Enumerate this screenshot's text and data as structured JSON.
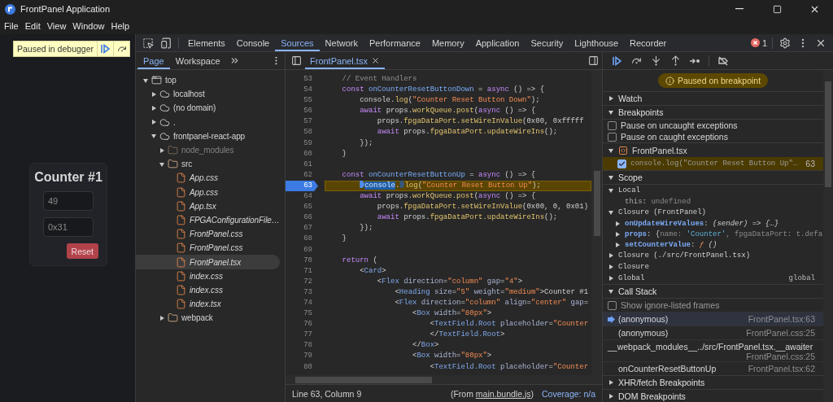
{
  "window": {
    "title": "FrontPanel Application"
  },
  "menu": [
    "File",
    "Edit",
    "View",
    "Window",
    "Help"
  ],
  "app": {
    "banner": "Paused in debugger",
    "card": {
      "title": "Counter #1",
      "fields": [
        {
          "value": "49"
        },
        {
          "value": "0x31"
        }
      ],
      "button": "Reset"
    }
  },
  "devtools_tabs": [
    {
      "label": "Elements",
      "selected": false
    },
    {
      "label": "Console",
      "selected": false
    },
    {
      "label": "Sources",
      "selected": true
    },
    {
      "label": "Network",
      "selected": false
    },
    {
      "label": "Performance",
      "selected": false
    },
    {
      "label": "Memory",
      "selected": false
    },
    {
      "label": "Application",
      "selected": false
    },
    {
      "label": "Security",
      "selected": false
    },
    {
      "label": "Lighthouse",
      "selected": false
    },
    {
      "label": "Recorder",
      "selected": false
    }
  ],
  "error_count": "1",
  "navigator": {
    "tabs": [
      {
        "label": "Page",
        "selected": true
      },
      {
        "label": "Workspace",
        "selected": false
      }
    ],
    "tree": [
      {
        "kind": "frame",
        "label": "top",
        "expanded": true,
        "selected": false,
        "children": [
          {
            "kind": "domain",
            "label": "localhost",
            "expanded": false,
            "selected": false
          },
          {
            "kind": "domain",
            "label": "(no domain)",
            "expanded": false,
            "selected": false
          },
          {
            "kind": "domain",
            "label": ".",
            "expanded": false,
            "selected": false
          },
          {
            "kind": "domain",
            "label": "frontpanel-react-app",
            "expanded": true,
            "selected": false,
            "children": [
              {
                "kind": "folder",
                "label": "node_modules",
                "expanded": false,
                "ignored": true,
                "selected": false
              },
              {
                "kind": "folder",
                "label": "src",
                "expanded": true,
                "ignored": false,
                "selected": false,
                "children": [
                  {
                    "kind": "file",
                    "label": "App.css",
                    "selected": false
                  },
                  {
                    "kind": "file",
                    "label": "App.css",
                    "selected": false
                  },
                  {
                    "kind": "file",
                    "label": "App.tsx",
                    "selected": false
                  },
                  {
                    "kind": "file",
                    "label": "FPGAConfigurationFile…",
                    "selected": false
                  },
                  {
                    "kind": "file",
                    "label": "FrontPanel.css",
                    "selected": false
                  },
                  {
                    "kind": "file",
                    "label": "FrontPanel.css",
                    "selected": false
                  },
                  {
                    "kind": "file",
                    "label": "FrontPanel.tsx",
                    "selected": true
                  },
                  {
                    "kind": "file",
                    "label": "index.css",
                    "selected": false
                  },
                  {
                    "kind": "file",
                    "label": "index.css",
                    "selected": false
                  },
                  {
                    "kind": "file",
                    "label": "index.tsx",
                    "selected": false
                  }
                ]
              },
              {
                "kind": "folder",
                "label": "webpack",
                "expanded": false,
                "ignored": false,
                "selected": false
              }
            ]
          }
        ]
      }
    ]
  },
  "editor": {
    "tabs": [
      {
        "label": "FrontPanel.tsx",
        "selected": true
      }
    ],
    "lines": [
      {
        "number": "53",
        "breakpoint": false,
        "paused": false,
        "segments": [
          {
            "kind": "comment",
            "text": "    // Event Handlers"
          }
        ]
      },
      {
        "number": "54",
        "breakpoint": false,
        "paused": false,
        "segments": [
          {
            "kind": "keyword",
            "text": "    const "
          },
          {
            "kind": "definition",
            "text": "onCounterResetButtonDown"
          },
          {
            "kind": "plain",
            "text": " = "
          },
          {
            "kind": "keyword",
            "text": "async"
          },
          {
            "kind": "plain",
            "text": " () => {"
          }
        ]
      },
      {
        "number": "55",
        "breakpoint": false,
        "paused": false,
        "segments": [
          {
            "kind": "plain",
            "text": "        console."
          },
          {
            "kind": "member",
            "text": "log"
          },
          {
            "kind": "plain",
            "text": "("
          },
          {
            "kind": "string",
            "text": "\"Counter Reset Button Down\""
          },
          {
            "kind": "plain",
            "text": ");"
          }
        ]
      },
      {
        "number": "56",
        "breakpoint": false,
        "paused": false,
        "segments": [
          {
            "kind": "keyword",
            "text": "        await "
          },
          {
            "kind": "plain",
            "text": "props."
          },
          {
            "kind": "member",
            "text": "workQueue.post"
          },
          {
            "kind": "plain",
            "text": "("
          },
          {
            "kind": "keyword",
            "text": "async"
          },
          {
            "kind": "plain",
            "text": " () => {"
          }
        ]
      },
      {
        "number": "57",
        "breakpoint": false,
        "paused": false,
        "segments": [
          {
            "kind": "plain",
            "text": "            props."
          },
          {
            "kind": "member",
            "text": "fpgaDataPort.setWireInValue"
          },
          {
            "kind": "plain",
            "text": "(0x00, 0xfffff"
          }
        ]
      },
      {
        "number": "58",
        "breakpoint": false,
        "paused": false,
        "segments": [
          {
            "kind": "keyword",
            "text": "            await "
          },
          {
            "kind": "plain",
            "text": "props."
          },
          {
            "kind": "member",
            "text": "fpgaDataPort.updateWireIns"
          },
          {
            "kind": "plain",
            "text": "();"
          }
        ]
      },
      {
        "number": "59",
        "breakpoint": false,
        "paused": false,
        "segments": [
          {
            "kind": "plain",
            "text": "        });"
          }
        ]
      },
      {
        "number": "60",
        "breakpoint": false,
        "paused": false,
        "segments": [
          {
            "kind": "plain",
            "text": "    }"
          }
        ]
      },
      {
        "number": "61",
        "breakpoint": false,
        "paused": false
      },
      {
        "number": "62",
        "breakpoint": false,
        "paused": false,
        "segments": [
          {
            "kind": "keyword",
            "text": "    const "
          },
          {
            "kind": "definition",
            "text": "onCounterResetButtonUp"
          },
          {
            "kind": "plain",
            "text": " = "
          },
          {
            "kind": "keyword",
            "text": "async"
          },
          {
            "kind": "plain",
            "text": " () => {"
          }
        ]
      },
      {
        "number": "63",
        "breakpoint": true,
        "paused": true,
        "segments": [
          {
            "kind": "paused-selection",
            "text": "        console"
          },
          {
            "kind": "plain",
            "text": "."
          },
          {
            "kind": "member-breakpoint",
            "text": "log"
          },
          {
            "kind": "plain",
            "text": "("
          },
          {
            "kind": "string",
            "text": "\"Counter Reset Button Up\""
          },
          {
            "kind": "plain",
            "text": ");"
          }
        ]
      },
      {
        "number": "64",
        "breakpoint": false,
        "paused": false,
        "segments": [
          {
            "kind": "keyword",
            "text": "        await "
          },
          {
            "kind": "plain",
            "text": "props."
          },
          {
            "kind": "member",
            "text": "workQueue.post"
          },
          {
            "kind": "plain",
            "text": "("
          },
          {
            "kind": "keyword",
            "text": "async"
          },
          {
            "kind": "plain",
            "text": " () => {"
          }
        ]
      },
      {
        "number": "65",
        "breakpoint": false,
        "paused": false,
        "segments": [
          {
            "kind": "plain",
            "text": "            props."
          },
          {
            "kind": "member",
            "text": "fpgaDataPort.setWireInValue"
          },
          {
            "kind": "plain",
            "text": "(0x00, 0, 0x01)"
          }
        ]
      },
      {
        "number": "66",
        "breakpoint": false,
        "paused": false,
        "segments": [
          {
            "kind": "keyword",
            "text": "            await "
          },
          {
            "kind": "plain",
            "text": "props."
          },
          {
            "kind": "member",
            "text": "fpgaDataPort.updateWireIns"
          },
          {
            "kind": "plain",
            "text": "();"
          }
        ]
      },
      {
        "number": "67",
        "breakpoint": false,
        "paused": false,
        "segments": [
          {
            "kind": "plain",
            "text": "        });"
          }
        ]
      },
      {
        "number": "68",
        "breakpoint": false,
        "paused": false,
        "segments": [
          {
            "kind": "plain",
            "text": "    }"
          }
        ]
      },
      {
        "number": "69",
        "breakpoint": false,
        "paused": false
      },
      {
        "number": "70",
        "breakpoint": false,
        "paused": false,
        "segments": [
          {
            "kind": "keyword",
            "text": "    return"
          },
          {
            "kind": "plain",
            "text": " ("
          }
        ]
      },
      {
        "number": "71",
        "breakpoint": false,
        "paused": false,
        "segments": [
          {
            "kind": "plain",
            "text": "        <"
          },
          {
            "kind": "tag",
            "text": "Card"
          },
          {
            "kind": "plain",
            "text": ">"
          }
        ]
      },
      {
        "number": "72",
        "breakpoint": false,
        "paused": false,
        "segments": [
          {
            "kind": "plain",
            "text": "            <"
          },
          {
            "kind": "tag",
            "text": "Flex"
          },
          {
            "kind": "attribute",
            "text": " direction"
          },
          {
            "kind": "plain",
            "text": "="
          },
          {
            "kind": "string",
            "text": "\"column\""
          },
          {
            "kind": "attribute",
            "text": " gap"
          },
          {
            "kind": "plain",
            "text": "="
          },
          {
            "kind": "string",
            "text": "\"4\""
          },
          {
            "kind": "plain",
            "text": ">"
          }
        ]
      },
      {
        "number": "73",
        "breakpoint": false,
        "paused": false,
        "segments": [
          {
            "kind": "plain",
            "text": "                <"
          },
          {
            "kind": "tag",
            "text": "Heading"
          },
          {
            "kind": "attribute",
            "text": " size"
          },
          {
            "kind": "plain",
            "text": "="
          },
          {
            "kind": "string",
            "text": "\"5\""
          },
          {
            "kind": "attribute",
            "text": " weight"
          },
          {
            "kind": "plain",
            "text": "="
          },
          {
            "kind": "string",
            "text": "\"medium\""
          },
          {
            "kind": "plain",
            "text": ">Counter #1"
          }
        ]
      },
      {
        "number": "74",
        "breakpoint": false,
        "paused": false,
        "segments": [
          {
            "kind": "plain",
            "text": "                <"
          },
          {
            "kind": "tag",
            "text": "Flex"
          },
          {
            "kind": "attribute",
            "text": " direction"
          },
          {
            "kind": "plain",
            "text": "="
          },
          {
            "kind": "string",
            "text": "\"column\""
          },
          {
            "kind": "attribute",
            "text": " align"
          },
          {
            "kind": "plain",
            "text": "="
          },
          {
            "kind": "string",
            "text": "\"center\""
          },
          {
            "kind": "attribute",
            "text": " gap"
          },
          {
            "kind": "plain",
            "text": "="
          }
        ]
      },
      {
        "number": "75",
        "breakpoint": false,
        "paused": false,
        "segments": [
          {
            "kind": "plain",
            "text": "                    <"
          },
          {
            "kind": "tag",
            "text": "Box"
          },
          {
            "kind": "attribute",
            "text": " width"
          },
          {
            "kind": "plain",
            "text": "="
          },
          {
            "kind": "string",
            "text": "\"80px\""
          },
          {
            "kind": "plain",
            "text": ">"
          }
        ]
      },
      {
        "number": "76",
        "breakpoint": false,
        "paused": false,
        "segments": [
          {
            "kind": "plain",
            "text": "                        <"
          },
          {
            "kind": "tag",
            "text": "TextField.Root"
          },
          {
            "kind": "attribute",
            "text": " placeholder"
          },
          {
            "kind": "plain",
            "text": "="
          },
          {
            "kind": "string",
            "text": "\"Counter"
          }
        ]
      },
      {
        "number": "77",
        "breakpoint": false,
        "paused": false,
        "segments": [
          {
            "kind": "plain",
            "text": "                        </"
          },
          {
            "kind": "tag",
            "text": "TextField.Root"
          },
          {
            "kind": "plain",
            "text": ">"
          }
        ]
      },
      {
        "number": "78",
        "breakpoint": false,
        "paused": false,
        "segments": [
          {
            "kind": "plain",
            "text": "                    </"
          },
          {
            "kind": "tag",
            "text": "Box"
          },
          {
            "kind": "plain",
            "text": ">"
          }
        ]
      },
      {
        "number": "79",
        "breakpoint": false,
        "paused": false,
        "segments": [
          {
            "kind": "plain",
            "text": "                    <"
          },
          {
            "kind": "tag",
            "text": "Box"
          },
          {
            "kind": "attribute",
            "text": " width"
          },
          {
            "kind": "plain",
            "text": "="
          },
          {
            "kind": "string",
            "text": "\"80px\""
          },
          {
            "kind": "plain",
            "text": ">"
          }
        ]
      },
      {
        "number": "80",
        "breakpoint": false,
        "paused": false,
        "segments": [
          {
            "kind": "plain",
            "text": "                        <"
          },
          {
            "kind": "tag",
            "text": "TextField.Root"
          },
          {
            "kind": "attribute",
            "text": " placeholder"
          },
          {
            "kind": "plain",
            "text": "="
          },
          {
            "kind": "string",
            "text": "\"Counter"
          }
        ]
      }
    ],
    "status": {
      "position": "Line 63, Column 9",
      "source_prefix": "(From",
      "source_link": "main.bundle.js",
      "source_suffix": ")",
      "coverage": "Coverage: n/a"
    }
  },
  "debugger": {
    "paused_message": "Paused on breakpoint",
    "sections": [
      {
        "kind": "plain",
        "title": "Watch",
        "expanded": false
      },
      {
        "kind": "breakpoints",
        "title": "Breakpoints",
        "expanded": true,
        "options": [
          {
            "label": "Pause on uncaught exceptions",
            "checked": false
          },
          {
            "label": "Pause on caught exceptions",
            "checked": false
          }
        ],
        "files": [
          {
            "name": "FrontPanel.tsx",
            "expanded": true,
            "items": [
              {
                "code": "console.log(\"Counter Reset Button Up\"…",
                "line": "63",
                "checked": true,
                "active": true
              }
            ]
          }
        ]
      },
      {
        "kind": "scope",
        "title": "Scope",
        "expanded": true,
        "groups": [
          {
            "label": "Local",
            "expanded": true,
            "children": [
              {
                "kind": "leaf",
                "segments": [
                  {
                    "kind": "name",
                    "text": "this"
                  },
                  {
                    "kind": "plain",
                    "text": ": "
                  },
                  {
                    "kind": "dim",
                    "text": "undefined"
                  }
                ]
              }
            ]
          },
          {
            "label": "Closure (FrontPanel)",
            "expanded": true,
            "children": [
              {
                "kind": "node",
                "expanded": false,
                "segments": [
                  {
                    "kind": "property",
                    "text": "onUpdateWireValues"
                  },
                  {
                    "kind": "plain",
                    "text": ": "
                  },
                  {
                    "kind": "function",
                    "text": "(sender) => {…}"
                  }
                ]
              },
              {
                "kind": "node",
                "expanded": false,
                "segments": [
                  {
                    "kind": "property",
                    "text": "props"
                  },
                  {
                    "kind": "plain",
                    "text": ": {"
                  },
                  {
                    "kind": "dim",
                    "text": "name: "
                  },
                  {
                    "kind": "value-string",
                    "text": "'Counter'"
                  },
                  {
                    "kind": "dim",
                    "text": ", fpgaDataPort: t.defa"
                  }
                ]
              },
              {
                "kind": "node",
                "expanded": false,
                "segments": [
                  {
                    "kind": "property",
                    "text": "setCounterValue"
                  },
                  {
                    "kind": "plain",
                    "text": ": "
                  },
                  {
                    "kind": "function-keyword",
                    "text": "ƒ"
                  },
                  {
                    "kind": "function",
                    "text": " ()"
                  }
                ]
              }
            ]
          },
          {
            "label": "Closure (./src/FrontPanel.tsx)",
            "expanded": false
          },
          {
            "label": "Closure",
            "expanded": false
          },
          {
            "label": "Global",
            "expanded": false,
            "value": "global"
          }
        ]
      },
      {
        "kind": "call_stack",
        "title": "Call Stack",
        "expanded": true,
        "option": {
          "label": "Show ignore-listed frames",
          "checked": false
        },
        "frames": [
          {
            "name": "(anonymous)",
            "location": "FrontPanel.tsx:63",
            "selected": true
          },
          {
            "name": "(anonymous)",
            "location": "FrontPanel.css:25",
            "selected": false
          },
          {
            "name": "__webpack_modules__../src/FrontPanel.tsx.__awaiter",
            "location": "FrontPanel.css:25",
            "selected": false
          },
          {
            "name": "onCounterResetButtonUp",
            "location": "FrontPanel.tsx:62",
            "selected": false
          }
        ]
      },
      {
        "kind": "plain",
        "title": "XHR/fetch Breakpoints",
        "expanded": false
      },
      {
        "kind": "plain",
        "title": "DOM Breakpoints",
        "expanded": false
      }
    ]
  }
}
